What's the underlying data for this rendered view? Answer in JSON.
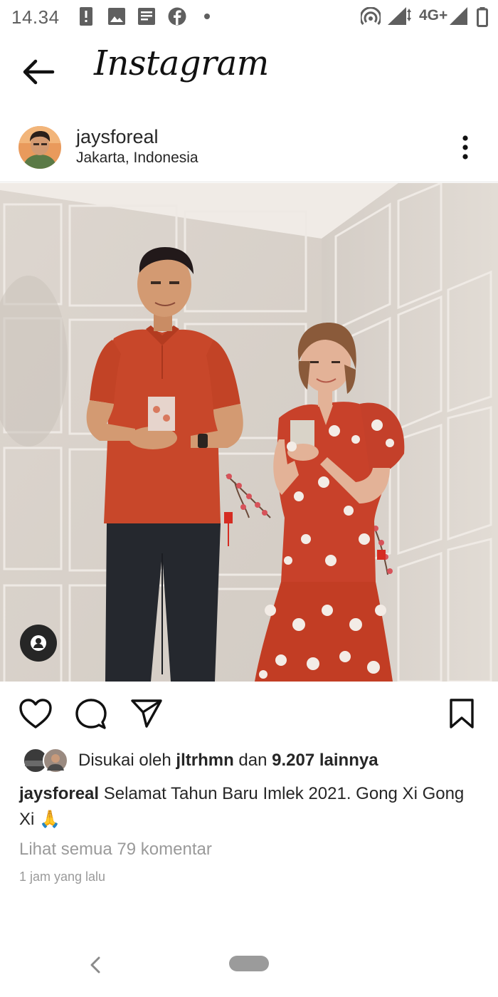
{
  "status_bar": {
    "time": "14.34",
    "network": "4G+",
    "icons": [
      "alert-icon",
      "image-icon",
      "news-icon",
      "facebook-icon",
      "dot-icon",
      "hotspot-icon",
      "signal-icon",
      "battery-icon"
    ]
  },
  "header": {
    "app_title": "Instagram",
    "back_icon": "arrow-left-icon"
  },
  "post": {
    "username": "jaysforeal",
    "location": "Jakarta, Indonesia",
    "more_icon": "more-vertical-icon",
    "photo_icons": [
      "tag-people-icon"
    ]
  },
  "actions": {
    "icons": [
      "heart-icon",
      "comment-icon",
      "share-icon",
      "bookmark-icon"
    ]
  },
  "likes": {
    "prefix": "Disukai oleh ",
    "user": "jltrhmn",
    "middle": " dan ",
    "count": "9.207 lainnya"
  },
  "caption": {
    "username": "jaysforeal",
    "text": " Selamat Tahun Baru Imlek 2021. Gong Xi Gong Xi 🙏"
  },
  "comments_link": "Lihat semua 79 komentar",
  "timestamp": "1 jam yang lalu",
  "colors": {
    "text": "#262626",
    "muted": "#9a9a9a",
    "shirt": "#c8472a",
    "dress": "#c23d24"
  }
}
